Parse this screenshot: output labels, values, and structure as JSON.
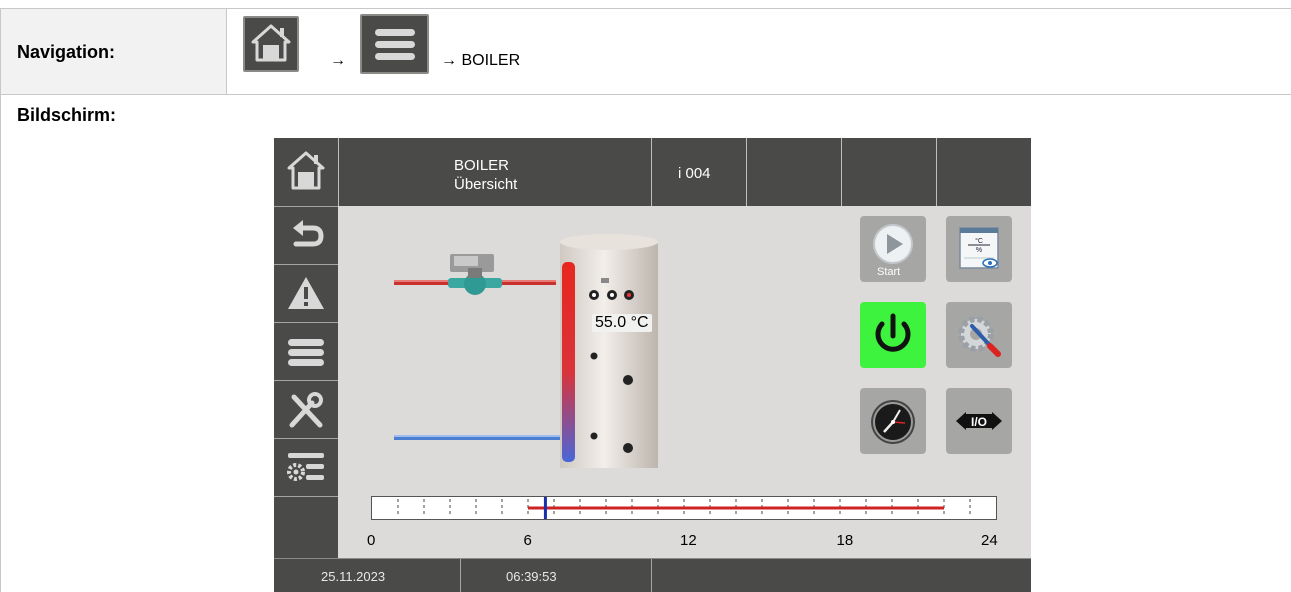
{
  "doc": {
    "navigation_label": "Navigation:",
    "arrow_1": "→",
    "arrow_2": "→ BOILER",
    "screen_label": "Bildschirm:"
  },
  "header": {
    "title_line1": "BOILER",
    "title_line2": "Übersicht",
    "info": "i  004"
  },
  "boiler": {
    "temperature": "55.0 °C"
  },
  "controls": {
    "start_label": "Start",
    "io_label": "I/O"
  },
  "timeline": {
    "ticks": [
      "0",
      "6",
      "12",
      "18",
      "24"
    ],
    "current_hour": 6.67,
    "active_from_hour": 6,
    "active_to_hour": 22
  },
  "footer": {
    "date": "25.11.2023",
    "time": "06:39:53"
  },
  "colors": {
    "panel": "#4a4a48",
    "screen_bg": "#dddbd9",
    "power_on": "#3ef33e",
    "hot_pipe": "#c8312d",
    "cold_pipe": "#4a7ed0",
    "timeline_active": "#cc2222",
    "timeline_marker": "#1a2fb0"
  },
  "icons": [
    "home-icon",
    "menu-icon",
    "back-icon",
    "warning-icon",
    "tools-icon",
    "settings-list-icon",
    "play-icon",
    "view-values-icon",
    "power-icon",
    "service-icon",
    "clock-icon",
    "io-icon",
    "pump-icon",
    "boiler-tank-icon"
  ]
}
